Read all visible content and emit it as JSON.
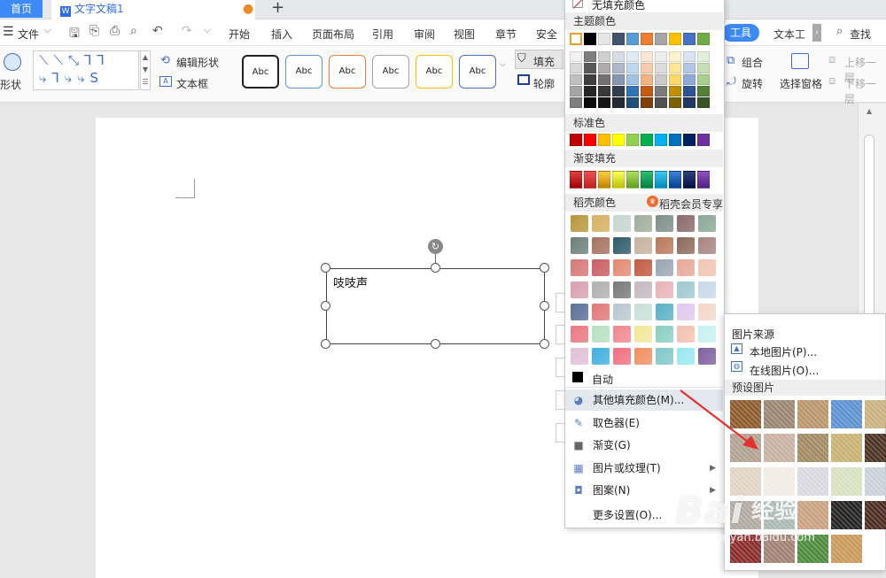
{
  "tabs": {
    "home": "首页",
    "doc": "文字文稿1"
  },
  "menu": {
    "file": "文件",
    "items": [
      {
        "label": "开始",
        "name": "menu-start"
      },
      {
        "label": "插入",
        "name": "menu-insert"
      },
      {
        "label": "页面布局",
        "name": "menu-layout"
      },
      {
        "label": "引用",
        "name": "menu-reference"
      },
      {
        "label": "审阅",
        "name": "menu-review"
      },
      {
        "label": "视图",
        "name": "menu-view"
      },
      {
        "label": "章节",
        "name": "menu-section"
      },
      {
        "label": "安全",
        "name": "menu-security"
      }
    ],
    "draw_tool": "工具",
    "text_tool": "文本工",
    "search": "查找"
  },
  "ribbon": {
    "shape": "形状",
    "edit_shape": "编辑形状",
    "text_box": "文本框",
    "styles": [
      "Abc",
      "Abc",
      "Abc",
      "Abc",
      "Abc",
      "Abc"
    ],
    "style_colors": [
      "#222222",
      "#5b9bd5",
      "#ed7d31",
      "#a5a5a5",
      "#ffc000",
      "#4472c4"
    ],
    "fill": "填充",
    "outline": "轮廓",
    "group": "组合",
    "rotate": "旋转",
    "select_pane": "选择窗格",
    "bring_forward": "上移一层",
    "send_backward": "下移一层"
  },
  "document": {
    "text": "吱吱声"
  },
  "fill_menu": {
    "no_fill": "无填充颜色",
    "theme_colors": "主题颜色",
    "standard_colors": "标准色",
    "gradient_fill": "渐变填充",
    "daoke_colors": "稻壳颜色",
    "member": "稻壳会员专享",
    "auto": "自动",
    "theme_top": [
      "#ffffff",
      "#000000",
      "#e7e6e6",
      "#44546a",
      "#5b9bd5",
      "#ed7d31",
      "#a5a5a5",
      "#ffc000",
      "#4472c4",
      "#70ad47"
    ],
    "theme_shades": [
      [
        "#f2f2f2",
        "#7f7f7f",
        "#d0cece",
        "#d6dce4",
        "#deebf6",
        "#fbe5d5",
        "#ededed",
        "#fff2cc",
        "#dae3f3",
        "#e2efd9"
      ],
      [
        "#d8d8d8",
        "#595959",
        "#aeabab",
        "#adb9ca",
        "#bdd7ee",
        "#f8cbad",
        "#dbdbdb",
        "#fee599",
        "#b4c6e7",
        "#c5e0b3"
      ],
      [
        "#bfbfbf",
        "#3f3f3f",
        "#757070",
        "#8496b0",
        "#9dc3e6",
        "#f4b183",
        "#c9c9c9",
        "#ffd965",
        "#8eaadb",
        "#a8d08d"
      ],
      [
        "#a5a5a5",
        "#262626",
        "#3a3838",
        "#323f4f",
        "#2e75b5",
        "#c55a11",
        "#7b7b7b",
        "#bf9000",
        "#2f5496",
        "#538135"
      ],
      [
        "#7f7f7f",
        "#0c0c0c",
        "#171616",
        "#222a35",
        "#1e4e79",
        "#833c0b",
        "#525252",
        "#7f6000",
        "#1f3864",
        "#375623"
      ]
    ],
    "standard": [
      "#c00000",
      "#ff0000",
      "#ffc000",
      "#ffff00",
      "#92d050",
      "#00b050",
      "#00b0f0",
      "#0070c0",
      "#002060",
      "#7030a0"
    ],
    "gradients": [
      [
        "#e04040",
        "#a00000"
      ],
      [
        "#f05050",
        "#c02020"
      ],
      [
        "#ffd040",
        "#c08000"
      ],
      [
        "#ffff60",
        "#c0c000"
      ],
      [
        "#b0e060",
        "#60a020"
      ],
      [
        "#30c070",
        "#008040"
      ],
      [
        "#40c8f0",
        "#0088c0"
      ],
      [
        "#4080d0",
        "#004090"
      ],
      [
        "#304080",
        "#001040"
      ],
      [
        "#9050c0",
        "#502080"
      ]
    ],
    "daoke": [
      [
        "#b8963c",
        "#d7b062",
        "#c8d5d0",
        "#9fae9a",
        "#7d8f8a",
        "#8a6a6a",
        "#8aa897"
      ],
      [
        "#6d7f7a",
        "#a7725f",
        "#2f5a6a",
        "#c9b19f",
        "#b87a5a",
        "#8c6a5a",
        "#a88480"
      ],
      [
        "#d67878",
        "#c95d62",
        "#e38a72",
        "#c25a42",
        "#9aa4b2",
        "#e6a89a",
        "#f2c4b2"
      ],
      [
        "#d8a0b0",
        "#b0b0b0",
        "#7a7a7a",
        "#c6b8c0",
        "#e8b4b8",
        "#a0c8d0",
        "#c8d8e8"
      ],
      [
        "#5a7098",
        "#e07878",
        "#b8c8d0",
        "#c8e0d8",
        "#5ab0c8",
        "#e0c8f0",
        "#f4d8c8"
      ],
      [
        "#e87880",
        "#b8e0c0",
        "#f08890",
        "#f0e898",
        "#88d0c0",
        "#f4c0b0",
        "#c8f0f0"
      ],
      [
        "#e0c0d8",
        "#40b0e0",
        "#f07080",
        "#f09060",
        "#80c8c8",
        "#98e8f0",
        "#8060a0"
      ]
    ],
    "items": [
      {
        "label": "其他填充颜色(M)...",
        "name": "more-fill-colors-item",
        "icon": "color-wheel-icon",
        "arrow": false
      },
      {
        "label": "取色器(E)",
        "name": "eyedropper-item",
        "icon": "eyedropper-icon",
        "arrow": false
      },
      {
        "label": "渐变(G)",
        "name": "gradient-item",
        "icon": "gradient-icon",
        "arrow": false
      },
      {
        "label": "图片或纹理(T)",
        "name": "picture-texture-item",
        "icon": "texture-icon",
        "arrow": true
      },
      {
        "label": "图案(N)",
        "name": "pattern-item",
        "icon": "pattern-icon",
        "arrow": true
      },
      {
        "label": "更多设置(O)...",
        "name": "more-settings-item",
        "icon": "",
        "arrow": false
      }
    ]
  },
  "pic_menu": {
    "source": "图片来源",
    "local": "本地图片(P)...",
    "online": "在线图片(O)...",
    "preset": "预设图片",
    "textures": [
      [
        "#8a5a2a",
        "#9a8470",
        "#b8946a",
        "#5a90d0",
        "#c8b080"
      ],
      [
        "#b0a090",
        "#c8b0a0",
        "#a08860",
        "#c8b070",
        "#4a3020"
      ],
      [
        "#e0d4c4",
        "#f0ece4",
        "#d8d8e0",
        "#d8e0c0",
        "#c8d0d8"
      ],
      [
        "#b0a8a0",
        "#a8b8b0",
        "#c8a080",
        "#202020",
        "#4a2a20"
      ],
      [
        "#8a2a2a",
        "#a08070",
        "#4a8a3a",
        "#c89858"
      ]
    ]
  },
  "watermark": {
    "brand": "Bai",
    "brand2": "经验",
    "url": "jingyan.baidu.com"
  }
}
